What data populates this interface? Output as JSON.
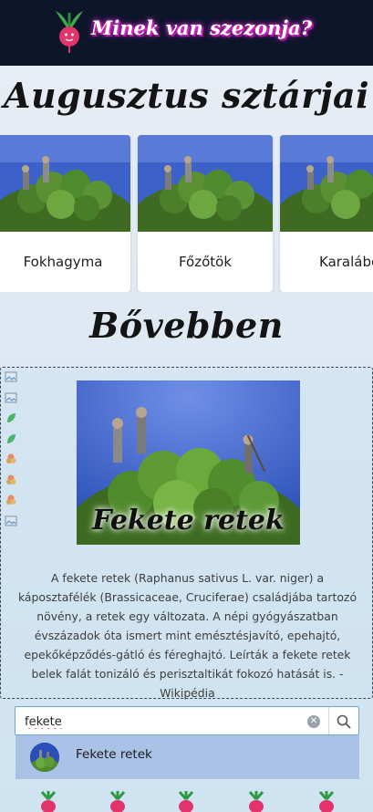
{
  "header": {
    "site_title": "Minek van szezonja?",
    "logo_icon": "radish-logo-icon"
  },
  "headings": {
    "month_stars": "Augusztus sztárjai",
    "more": "Bővebben"
  },
  "carousel": {
    "cards": [
      {
        "label": "Fokhagyma"
      },
      {
        "label": "Főzőtök"
      },
      {
        "label": "Karalábé"
      }
    ]
  },
  "detail": {
    "title": "Fekete retek",
    "description": "A fekete retek (Raphanus sativus L. var. niger) a káposztafélék (Brassicaceae, Cruciferae) családjába tartozó növény, a retek egy változata. A népi gyógyászatban évszázadok óta ismert mint emésztésjavító, epehajtó, epekőképződés-gátló és féreghajtó. Leírták a fekete retek belek falát tonizáló és perisztaltikát fokozó hatását is. - Wikipédia",
    "side_icons": [
      "broken-image-icon",
      "broken-image-icon",
      "leaf-icon",
      "leaf-icon",
      "flower-icon",
      "flower-icon",
      "flower-icon",
      "broken-image-icon"
    ]
  },
  "search": {
    "value": "fekete",
    "placeholder": "",
    "suggestions": [
      {
        "label": "Fekete retek"
      }
    ]
  },
  "colors": {
    "header_bg": "#0c1628",
    "title_glow": "#ff3fd7",
    "suggestion_bg": "#a9c2e6",
    "search_border": "#6aa6d8"
  }
}
